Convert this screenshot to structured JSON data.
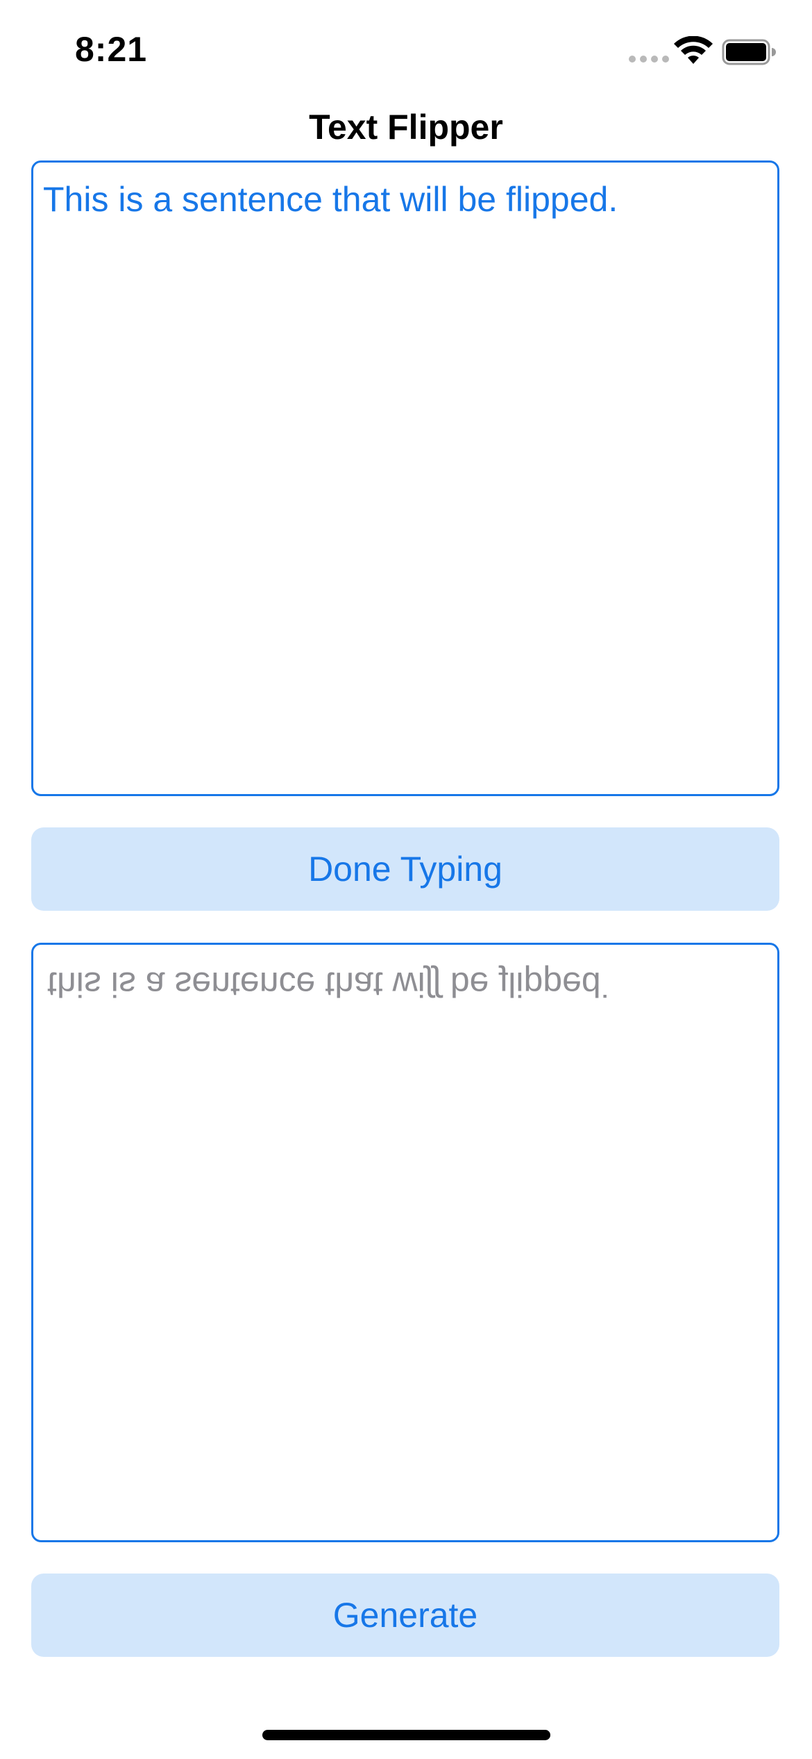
{
  "status_bar": {
    "time": "8:21",
    "icons": [
      "cellular-signal-icon",
      "wifi-icon",
      "battery-icon"
    ]
  },
  "nav": {
    "title": "Text Flipper"
  },
  "input": {
    "value": "This is a sentence that will be flipped."
  },
  "done_button": {
    "label": "Done Typing"
  },
  "output": {
    "value": "this is a sentence that wiʃʃ be ɟlipped˙"
  },
  "generate_button": {
    "label": "Generate"
  },
  "colors": {
    "accent": "#1777e8",
    "button_background": "#d2e6fb",
    "output_text": "#8e8e93"
  }
}
